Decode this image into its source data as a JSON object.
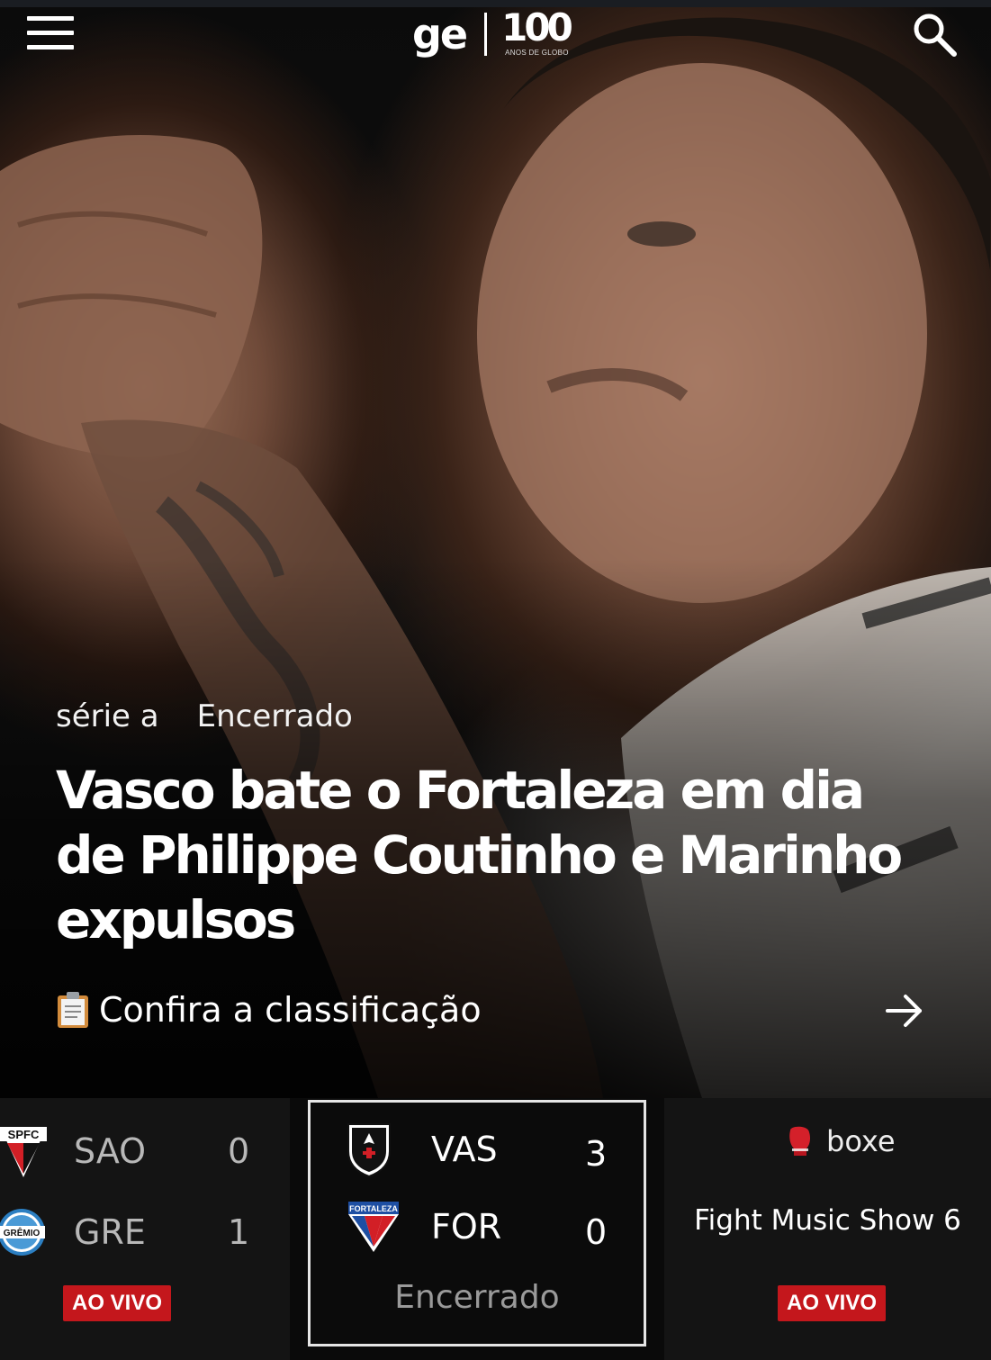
{
  "header": {
    "logo_ge": "ge",
    "logo_centenary_number": "100",
    "logo_centenary_sub": "ANOS DE GLOBO",
    "menu_icon": "hamburger-icon",
    "search_icon": "search-icon"
  },
  "hero": {
    "category": "série a",
    "status": "Encerrado",
    "headline": "Vasco bate o Fortaleza em dia de Philippe Coutinho e Marinho expulsos",
    "cta_label": "Confira a classificação",
    "cta_emoji": "clipboard-icon",
    "cta_arrow": "arrow-right-icon"
  },
  "score_strip": {
    "left_card": {
      "team1": {
        "abbr": "SAO",
        "score": "0",
        "crest_text": "SPFC"
      },
      "team2": {
        "abbr": "GRE",
        "score": "1",
        "crest_text": "GRÊMIO"
      },
      "badge": "AO VIVO"
    },
    "mid_card": {
      "team1": {
        "abbr": "VAS",
        "score": "3"
      },
      "team2": {
        "abbr": "FOR",
        "score": "0",
        "crest_text": "FORTALEZA"
      },
      "status": "Encerrado"
    },
    "right_card": {
      "category": "boxe",
      "category_icon": "boxing-glove-icon",
      "title": "Fight Music Show 6",
      "badge": "AO VIVO"
    }
  },
  "colors": {
    "live_badge": "#c4171c",
    "background": "#000000",
    "card_border": "#e6e6e6"
  }
}
